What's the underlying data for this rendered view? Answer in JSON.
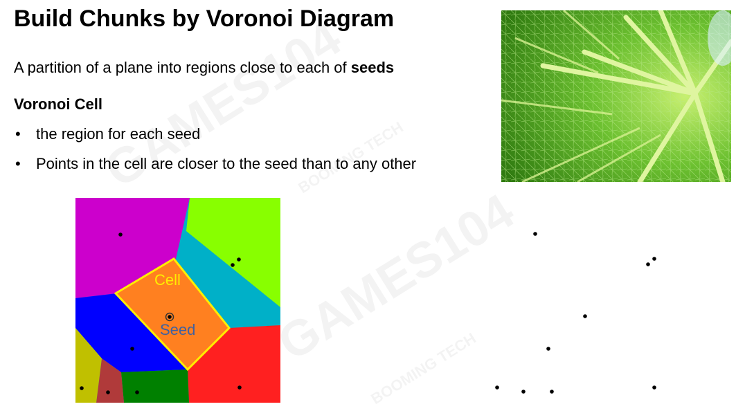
{
  "slide": {
    "title": "Build Chunks by Voronoi Diagram",
    "intro_text": "A partition of a plane into regions close to each of ",
    "intro_bold": "seeds",
    "subtitle": "Voronoi Cell",
    "bullets": [
      "the region for each seed",
      "Points in the cell are closer to the seed than to any other"
    ],
    "bullet_glyph": "•"
  },
  "diagram": {
    "cell_label": "Cell",
    "seed_label": "Seed",
    "colors": {
      "magenta": "#cc00cc",
      "lime": "#88ff00",
      "cyan": "#00b0c8",
      "blue": "#0000ff",
      "orange": "#ff8020",
      "olive": "#c0c000",
      "brown": "#b03a3a",
      "green": "#008000",
      "red": "#ff2020",
      "cell_outline": "#ffee00",
      "seed_text": "#4060a0"
    }
  },
  "watermark": {
    "text_main": "GAMES104",
    "text_brand": "BOOMING TECH"
  },
  "photo": {
    "subject": "leaf-vein-photo"
  }
}
